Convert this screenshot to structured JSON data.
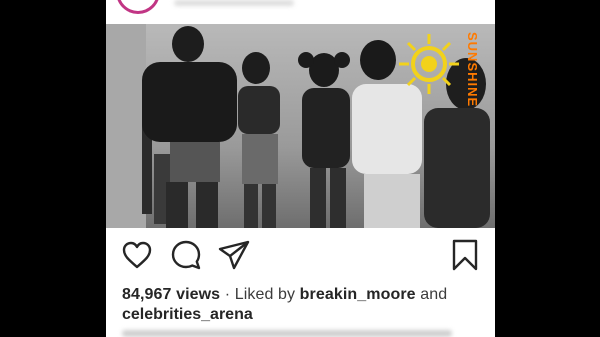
{
  "post": {
    "views_count": "84,967",
    "views_label": "views",
    "separator": "·",
    "liked_by_prefix": "Liked by",
    "liked_by_user": "breakin_moore",
    "and_text": "and",
    "second_user": "celebrities_arena"
  },
  "photo": {
    "watermark_text": "SUNSHINE"
  },
  "icons": {
    "like": "heart-icon",
    "comment": "comment-icon",
    "share": "share-icon",
    "save": "bookmark-icon"
  },
  "colors": {
    "text": "#262626",
    "ring": "#c13584",
    "watermark_sun": "#f2d21b",
    "watermark_text": "#ff7a00"
  }
}
